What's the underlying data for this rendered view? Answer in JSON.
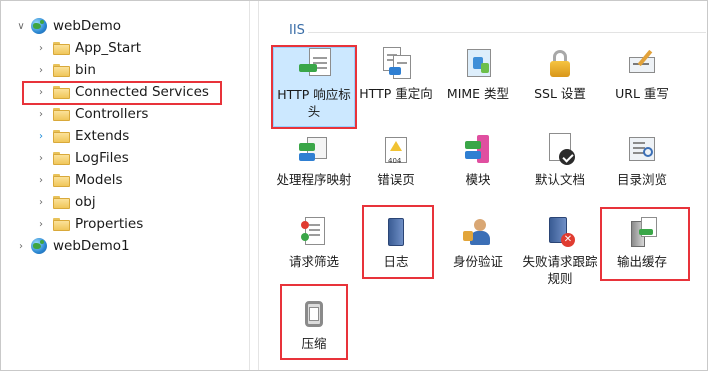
{
  "tree": {
    "items": [
      {
        "label": "webDemo",
        "expanded": true,
        "type": "site"
      },
      {
        "label": "App_Start",
        "type": "folder"
      },
      {
        "label": "bin",
        "type": "folder"
      },
      {
        "label": "Connected Services",
        "type": "folder",
        "highlighted": true
      },
      {
        "label": "Controllers",
        "type": "folder"
      },
      {
        "label": "Extends",
        "type": "folder"
      },
      {
        "label": "LogFiles",
        "type": "folder"
      },
      {
        "label": "Models",
        "type": "folder"
      },
      {
        "label": "obj",
        "type": "folder"
      },
      {
        "label": "Properties",
        "type": "folder"
      },
      {
        "label": "webDemo1",
        "expanded": false,
        "type": "site"
      }
    ]
  },
  "iis": {
    "section_title": "IIS",
    "features": [
      {
        "label": "HTTP 响应标头",
        "icon": "http-response-headers-icon",
        "selected": true,
        "highlighted": true
      },
      {
        "label": "HTTP 重定向",
        "icon": "http-redirect-icon"
      },
      {
        "label": "MIME 类型",
        "icon": "mime-types-icon"
      },
      {
        "label": "SSL 设置",
        "icon": "ssl-lock-icon"
      },
      {
        "label": "URL 重写",
        "icon": "url-rewrite-icon"
      },
      {
        "label": "处理程序映射",
        "icon": "handler-mappings-icon"
      },
      {
        "label": "错误页",
        "icon": "error-pages-icon"
      },
      {
        "label": "模块",
        "icon": "modules-icon"
      },
      {
        "label": "默认文档",
        "icon": "default-document-icon"
      },
      {
        "label": "目录浏览",
        "icon": "directory-browsing-icon"
      },
      {
        "label": "请求筛选",
        "icon": "request-filtering-icon"
      },
      {
        "label": "日志",
        "icon": "logging-icon",
        "highlighted": true
      },
      {
        "label": "身份验证",
        "icon": "authentication-icon"
      },
      {
        "label": "失败请求跟踪规则",
        "icon": "failed-request-tracing-icon"
      },
      {
        "label": "输出缓存",
        "icon": "output-caching-icon",
        "highlighted": true
      },
      {
        "label": "压缩",
        "icon": "compression-icon",
        "highlighted": true
      }
    ]
  },
  "colors": {
    "highlight_box": "#e8333a",
    "selection_bg": "#cce8ff",
    "section_title": "#3b6ea8"
  }
}
